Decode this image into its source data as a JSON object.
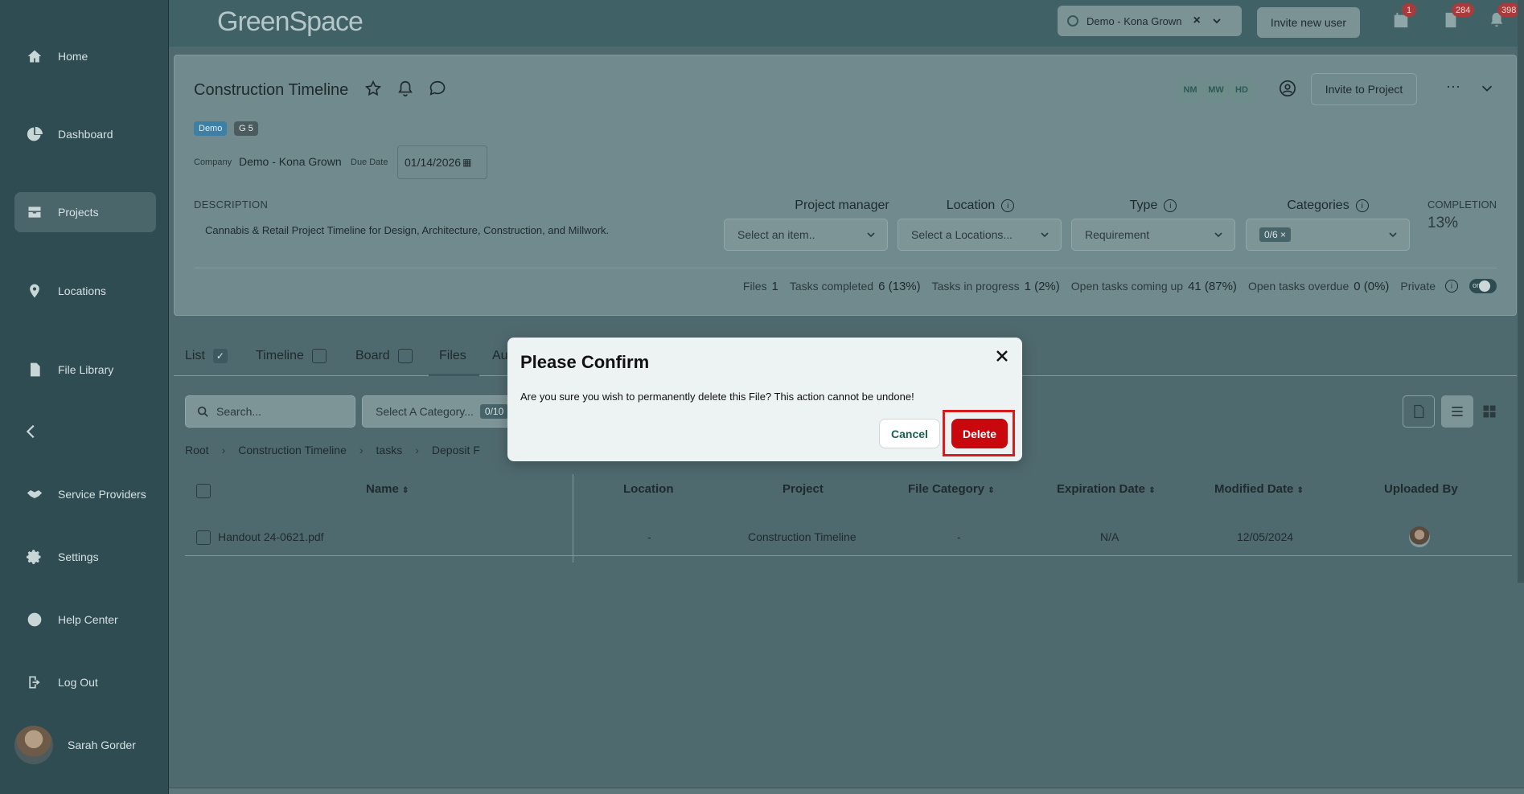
{
  "app": {
    "logo": "GreenSpace"
  },
  "sidebar": {
    "items": [
      {
        "label": "Home",
        "icon": "home-icon"
      },
      {
        "label": "Dashboard",
        "icon": "pie-chart-icon"
      },
      {
        "label": "Projects",
        "icon": "inbox-icon"
      },
      {
        "label": "Locations",
        "icon": "map-pin-icon"
      },
      {
        "label": "File Library",
        "icon": "file-icon"
      },
      {
        "label": "Service Providers",
        "icon": "handshake-icon"
      },
      {
        "label": "Settings",
        "icon": "gear-icon"
      },
      {
        "label": "Help Center",
        "icon": "question-circle-icon"
      },
      {
        "label": "Log Out",
        "icon": "logout-icon"
      }
    ],
    "user_name": "Sarah Gorder"
  },
  "header": {
    "org": "Demo - Kona Grown",
    "invite_user": "Invite new user",
    "badges": {
      "calendar": "1",
      "documents": "284",
      "notifications": "398"
    }
  },
  "project": {
    "title": "Construction Timeline",
    "tags": [
      "Demo",
      "G 5"
    ],
    "company_label": "Company",
    "company_value": "Demo - Kona Grown",
    "due_label": "Due Date",
    "due_value": "01/14/2026",
    "description_label": "DESCRIPTION",
    "description": "Cannabis & Retail Project Timeline for Design, Architecture, Construction, and Millwork.",
    "columns": {
      "manager": {
        "label": "Project manager",
        "value": "Select an item.."
      },
      "location": {
        "label": "Location",
        "value": "Select a Locations..."
      },
      "type": {
        "label": "Type",
        "value": "Requirement"
      },
      "categories": {
        "label": "Categories",
        "value": "0/6 ×"
      }
    },
    "completion_label": "COMPLETION",
    "completion_value": "13%",
    "members": [
      "NM",
      "MW",
      "HD"
    ],
    "invite_project": "Invite to Project",
    "more": "···",
    "stats": {
      "files_label": "Files",
      "files": "1",
      "completed_label": "Tasks completed",
      "completed": "6 (13%)",
      "progress_label": "Tasks in progress",
      "progress": "1 (2%)",
      "upcoming_label": "Open tasks coming up",
      "upcoming": "41 (87%)",
      "overdue_label": "Open tasks overdue",
      "overdue": "0 (0%)",
      "private_label": "Private",
      "toggle": "on"
    }
  },
  "tabs": [
    {
      "label": "List",
      "checked": true
    },
    {
      "label": "Timeline",
      "checked": false
    },
    {
      "label": "Board",
      "checked": false
    },
    {
      "label": "Files"
    },
    {
      "label": "Au"
    }
  ],
  "files": {
    "search_placeholder": "Search...",
    "category_placeholder": "Select A Category...",
    "category_count": "0/10",
    "breadcrumbs": [
      "Root",
      "Construction Timeline",
      "tasks",
      "Deposit F"
    ],
    "columns": [
      "Name",
      "Location",
      "Project",
      "File Category",
      "Expiration Date",
      "Modified Date",
      "Uploaded By"
    ],
    "rows": [
      {
        "name": "Handout 24-0621.pdf",
        "location": "-",
        "project": "Construction Timeline",
        "category": "-",
        "expiration": "N/A",
        "modified": "12/05/2024"
      }
    ]
  },
  "modal": {
    "title": "Please Confirm",
    "message": "Are you sure you wish to permanently delete this File? This action cannot be undone!",
    "cancel": "Cancel",
    "delete": "Delete"
  },
  "colors": {
    "accent": "#c8080c",
    "sidebar": "#2e4c52",
    "highlight": "#d81c1c"
  }
}
